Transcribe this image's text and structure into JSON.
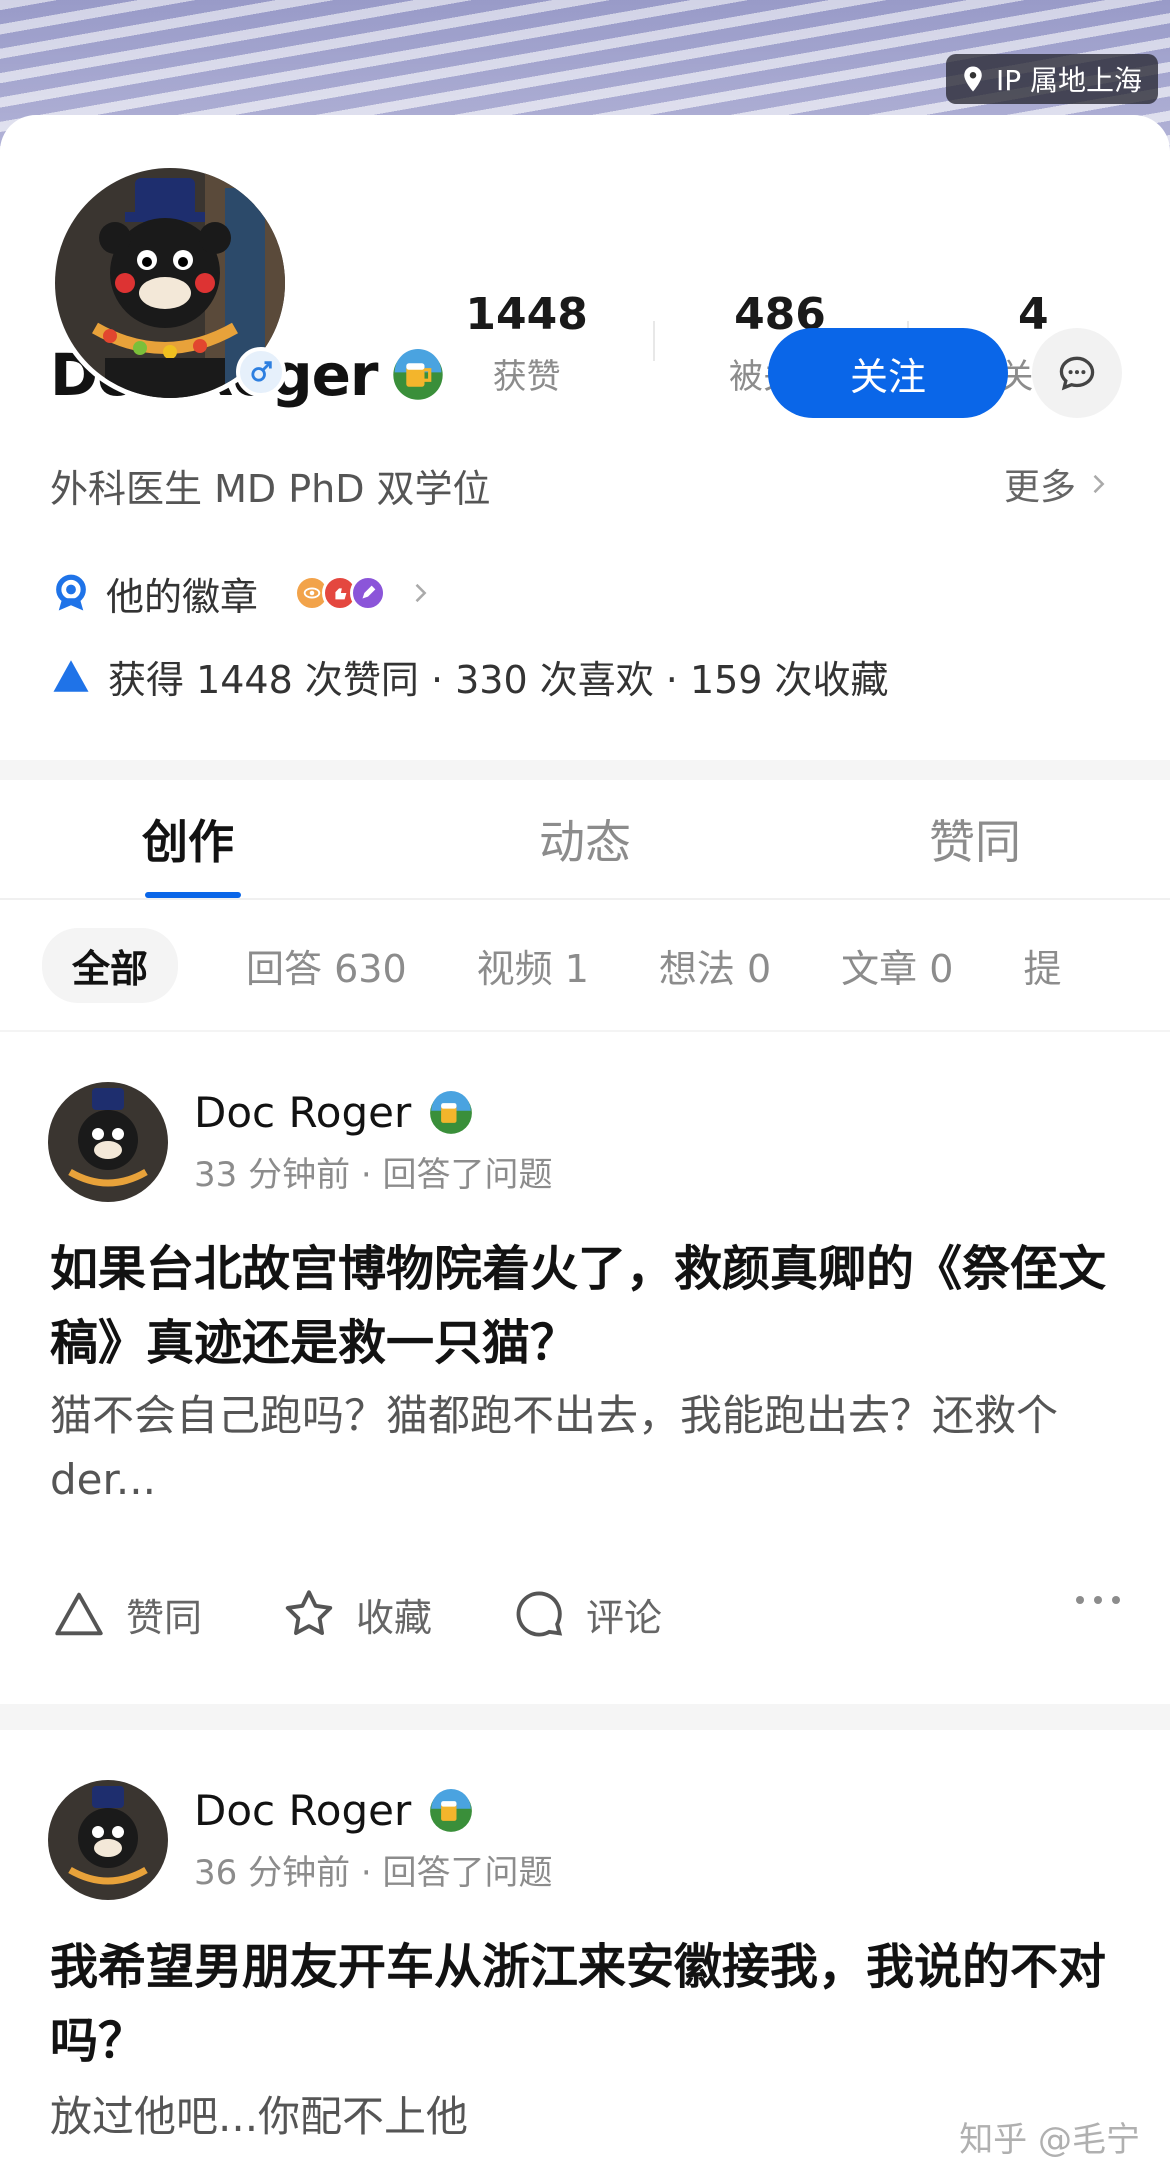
{
  "header": {
    "ip_label": "IP 属地上海"
  },
  "profile": {
    "name": "Doc Roger",
    "bio": "外科医生 MD PhD 双学位",
    "more_label": "更多",
    "follow_label": "关注",
    "stats": [
      {
        "value": "1448",
        "label": "获赞"
      },
      {
        "value": "486",
        "label": "被关注"
      },
      {
        "value": "4",
        "label": "关注"
      }
    ],
    "badges_label": "他的徽章",
    "agree_summary": "获得 1448 次赞同 · 330 次喜欢 · 159 次收藏"
  },
  "tabs": [
    {
      "label": "创作",
      "active": true
    },
    {
      "label": "动态",
      "active": false
    },
    {
      "label": "赞同",
      "active": false
    }
  ],
  "filters": [
    {
      "label": "全部",
      "active": true
    },
    {
      "label": "回答 630"
    },
    {
      "label": "视频 1"
    },
    {
      "label": "想法 0"
    },
    {
      "label": "文章 0"
    },
    {
      "label": "提"
    }
  ],
  "posts": [
    {
      "author": "Doc Roger",
      "meta": "33 分钟前 · 回答了问题",
      "title": "如果台北故宫博物院着火了，救颜真卿的《祭侄文稿》真迹还是救一只猫？",
      "excerpt": "猫不会自己跑吗？猫都跑不出去，我能跑出去？还救个der...",
      "actions": {
        "agree": "赞同",
        "collect": "收藏",
        "comment": "评论"
      }
    },
    {
      "author": "Doc Roger",
      "meta": "36 分钟前 · 回答了问题",
      "title": "我希望男朋友开车从浙江来安徽接我，我说的不对吗？",
      "excerpt": "放过他吧...你配不上他"
    }
  ],
  "watermark": "知乎 @毛宁",
  "colors": {
    "accent": "#0a66e8"
  }
}
